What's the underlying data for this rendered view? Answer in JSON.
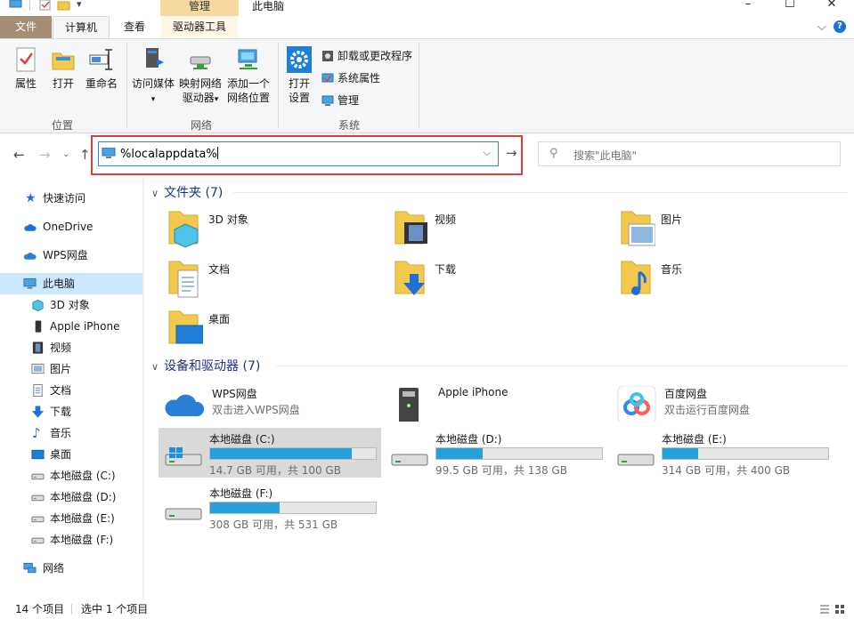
{
  "window": {
    "title": "此电脑",
    "contextual_tab": "管理",
    "buttons": {
      "minimize": "–",
      "maximize": "☐",
      "close": "✕"
    }
  },
  "tabs": {
    "file": "文件",
    "computer": "计算机",
    "view": "查看",
    "drive_tools": "驱动器工具"
  },
  "ribbon": {
    "location": {
      "label": "位置",
      "properties": "属性",
      "open": "打开",
      "rename": "重命名"
    },
    "network": {
      "label": "网络",
      "media_1": "访问媒体",
      "map_1": "映射网络",
      "map_2": "驱动器",
      "add_1": "添加一个",
      "add_2": "网络位置"
    },
    "system": {
      "label": "系统",
      "settings_1": "打开",
      "settings_2": "设置",
      "uninstall": "卸载或更改程序",
      "props": "系统属性",
      "manage": "管理"
    }
  },
  "address": {
    "value": "%localappdata%"
  },
  "search": {
    "placeholder": "搜索\"此电脑\""
  },
  "sidebar": {
    "items": [
      {
        "label": "快速访问"
      },
      {
        "label": "OneDrive"
      },
      {
        "label": "WPS网盘"
      },
      {
        "label": "此电脑"
      },
      {
        "label": "3D 对象"
      },
      {
        "label": "Apple iPhone"
      },
      {
        "label": "视频"
      },
      {
        "label": "图片"
      },
      {
        "label": "文档"
      },
      {
        "label": "下载"
      },
      {
        "label": "音乐"
      },
      {
        "label": "桌面"
      },
      {
        "label": "本地磁盘 (C:)"
      },
      {
        "label": "本地磁盘 (D:)"
      },
      {
        "label": "本地磁盘 (E:)"
      },
      {
        "label": "本地磁盘 (F:)"
      },
      {
        "label": "网络"
      }
    ]
  },
  "folders": {
    "header": "文件夹 (7)",
    "items": [
      {
        "label": "3D 对象"
      },
      {
        "label": "视频"
      },
      {
        "label": "图片"
      },
      {
        "label": "文档"
      },
      {
        "label": "下载"
      },
      {
        "label": "音乐"
      },
      {
        "label": "桌面"
      }
    ]
  },
  "devices": {
    "header": "设备和驱动器 (7)",
    "items": [
      {
        "label": "WPS网盘",
        "sub": "双击进入WPS网盘"
      },
      {
        "label": "Apple iPhone",
        "sub": ""
      },
      {
        "label": "百度网盘",
        "sub": "双击运行百度网盘"
      }
    ],
    "drives": [
      {
        "label": "本地磁盘 (C:)",
        "free": "14.7 GB 可用，共 100 GB",
        "used_fraction": 0.853
      },
      {
        "label": "本地磁盘 (D:)",
        "free": "99.5 GB 可用，共 138 GB",
        "used_fraction": 0.279
      },
      {
        "label": "本地磁盘 (E:)",
        "free": "314 GB 可用，共 400 GB",
        "used_fraction": 0.215
      },
      {
        "label": "本地磁盘 (F:)",
        "free": "308 GB 可用，共 531 GB",
        "used_fraction": 0.42
      }
    ]
  },
  "status": {
    "count": "14 个项目",
    "selected": "选中 1 个项目"
  }
}
